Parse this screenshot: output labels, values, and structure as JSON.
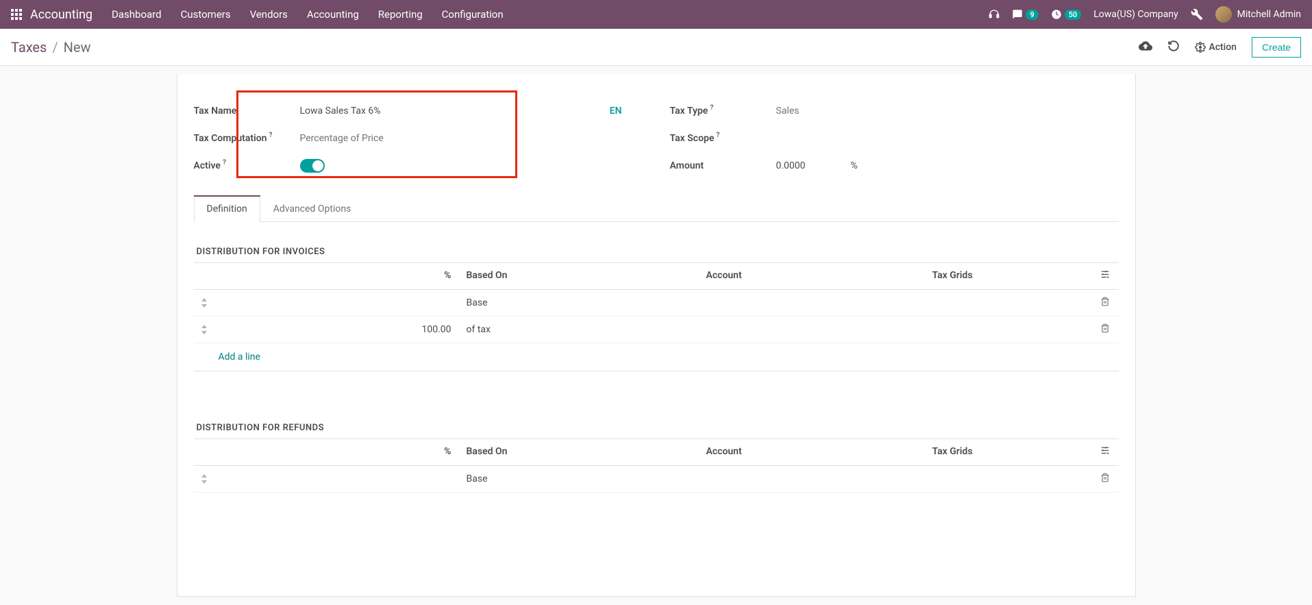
{
  "nav": {
    "app_name": "Accounting",
    "items": [
      "Dashboard",
      "Customers",
      "Vendors",
      "Accounting",
      "Reporting",
      "Configuration"
    ],
    "messages_count": "9",
    "activities_count": "50",
    "company": "Lowa(US) Company",
    "user": "Mitchell Admin"
  },
  "controls": {
    "breadcrumb_root": "Taxes",
    "breadcrumb_current": "New",
    "action_label": "Action",
    "create_label": "Create"
  },
  "form": {
    "labels": {
      "tax_name": "Tax Name",
      "tax_computation": "Tax Computation",
      "active": "Active",
      "tax_type": "Tax Type",
      "tax_scope": "Tax Scope",
      "amount": "Amount"
    },
    "values": {
      "tax_name": "Lowa Sales Tax 6%",
      "tax_computation": "Percentage of Price",
      "tax_type": "Sales",
      "tax_scope": "",
      "amount": "0.0000",
      "amount_suffix": "%"
    },
    "lang": "EN"
  },
  "tabs": {
    "definition": "Definition",
    "advanced": "Advanced Options"
  },
  "sections": {
    "invoices_title": "DISTRIBUTION FOR INVOICES",
    "refunds_title": "DISTRIBUTION FOR REFUNDS"
  },
  "columns": {
    "percent": "%",
    "based_on": "Based On",
    "account": "Account",
    "tax_grids": "Tax Grids"
  },
  "invoice_rows": [
    {
      "percent": "",
      "based_on": "Base"
    },
    {
      "percent": "100.00",
      "based_on": "of tax"
    }
  ],
  "refund_rows": [
    {
      "percent": "",
      "based_on": "Base"
    }
  ],
  "add_line": "Add a line"
}
